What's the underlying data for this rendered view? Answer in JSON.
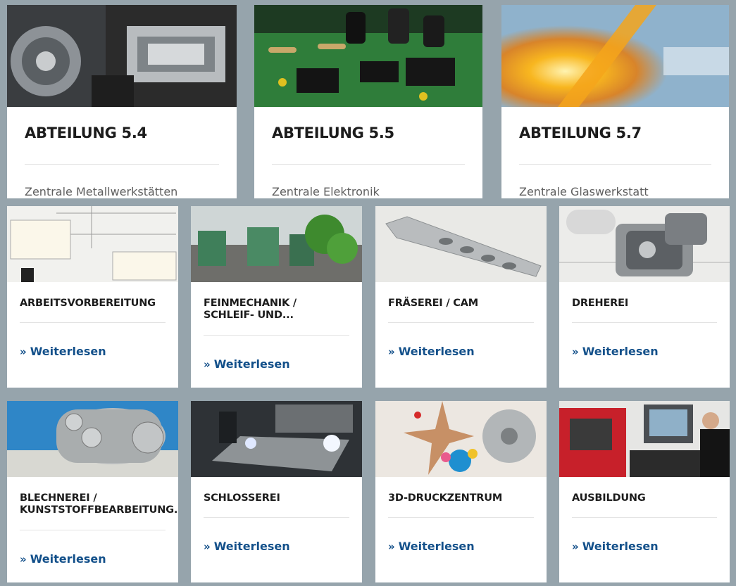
{
  "departments": [
    {
      "title": "ABTEILUNG 5.4",
      "subtitle": "Zentrale Metallwerkstätten"
    },
    {
      "title": "ABTEILUNG 5.5",
      "subtitle": "Zentrale Elektronik"
    },
    {
      "title": "ABTEILUNG 5.7",
      "subtitle": "Zentrale Glaswerkstatt"
    }
  ],
  "read_more_label": "Weiterlesen",
  "read_more_icon": "double-chevron-right-icon",
  "read_more_glyph": "»",
  "workshops": [
    {
      "title": "ARBEITSVORBEREITUNG"
    },
    {
      "title": "FEINMECHANIK /\nSCHLEIF- UND..."
    },
    {
      "title": "FRÄSEREI / CAM"
    },
    {
      "title": "DREHEREI"
    },
    {
      "title": "BLECHNEREI /\nKUNSTSTOFFBEARBEITUNG..."
    },
    {
      "title": "SCHLOSSEREI"
    },
    {
      "title": "3D-DRUCKZENTRUM"
    },
    {
      "title": "AUSBILDUNG"
    }
  ],
  "colors": {
    "background": "#96a4ac",
    "card": "#ffffff",
    "link": "#13508a",
    "title": "#1c1c1c",
    "subtitle": "#5f5f5f"
  }
}
